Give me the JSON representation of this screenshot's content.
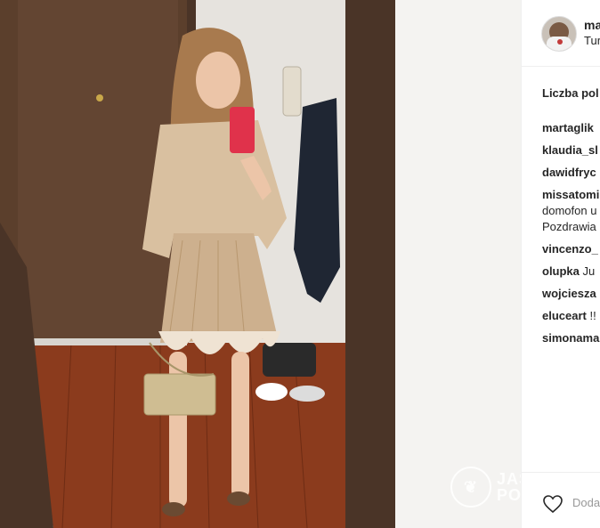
{
  "post": {
    "username": "ma",
    "location": "Tur",
    "likes_label": "Liczba pol",
    "comments": [
      {
        "user": "martaglik",
        "text": "",
        "extra": ""
      },
      {
        "user": "klaudia_sl",
        "text": "",
        "extra": ""
      },
      {
        "user": "dawidfryc",
        "text": "",
        "extra": ""
      },
      {
        "user": "missatomi",
        "text": "",
        "extra": "domofon u"
      },
      {
        "user": "",
        "text": "",
        "extra": "Pozdrawia"
      },
      {
        "user": "vincenzo_",
        "text": "",
        "extra": ""
      },
      {
        "user": "olupka",
        "text": " Ju",
        "extra": ""
      },
      {
        "user": "wojciesza",
        "text": "",
        "extra": ""
      },
      {
        "user": "eluceart",
        "text": " !!",
        "extra": ""
      },
      {
        "user": "simonama",
        "text": "",
        "extra": ""
      }
    ],
    "add_comment_placeholder": "Doda"
  },
  "watermark": {
    "text_line1": "JAS",
    "text_line2": "PO"
  },
  "colors": {
    "door": "#5a3e2b",
    "floor": "#8a3a1c",
    "mirror_frame": "#4a3427",
    "phone": "#e0324b",
    "dress": "#d9c0a0"
  }
}
